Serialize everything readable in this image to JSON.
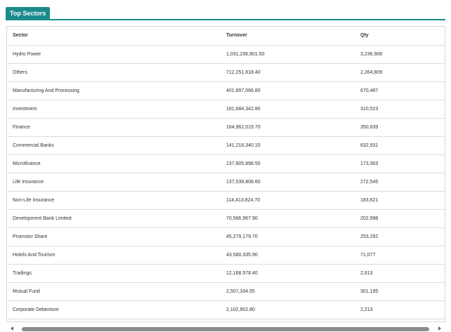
{
  "panel": {
    "title": "Top Sectors"
  },
  "table": {
    "headers": [
      "Sector",
      "Turnover",
      "Qty"
    ],
    "rows": [
      [
        "Hydro Power",
        "1,031,236,901.50",
        "3,236,906"
      ],
      [
        "Others",
        "712,251,818.40",
        "2,264,809"
      ],
      [
        "Manufacturing And Processing",
        "401,897,566.80",
        "670,487"
      ],
      [
        "Investment",
        "181,684,342.80",
        "310,523"
      ],
      [
        "Finance",
        "164,962,019.70",
        "350,639"
      ],
      [
        "Commercial Banks",
        "141,218,340.10",
        "632,931"
      ],
      [
        "Microfinance",
        "137,805,898.50",
        "173,303"
      ],
      [
        "Life Insurance",
        "137,539,808.60",
        "272,545"
      ],
      [
        "Non-Life Insurance",
        "114,413,824.70",
        "183,621"
      ],
      [
        "Development Bank Limited",
        "70,566,967.90",
        "202,998"
      ],
      [
        "Promotor Share",
        "45,279,179.70",
        "253,292"
      ],
      [
        "Hotels And Tourism",
        "43,580,335.90",
        "71,077"
      ],
      [
        "Tradings",
        "12,168,578.40",
        "2,613"
      ],
      [
        "Mutual Fund",
        "2,507,334.55",
        "301,195"
      ],
      [
        "Corporate Debenture",
        "2,102,902.80",
        "2,213"
      ]
    ]
  },
  "colors": {
    "accent": "#1b8a8c",
    "border": "#dcdcdc",
    "scroll_thumb": "#8c8c8c"
  }
}
